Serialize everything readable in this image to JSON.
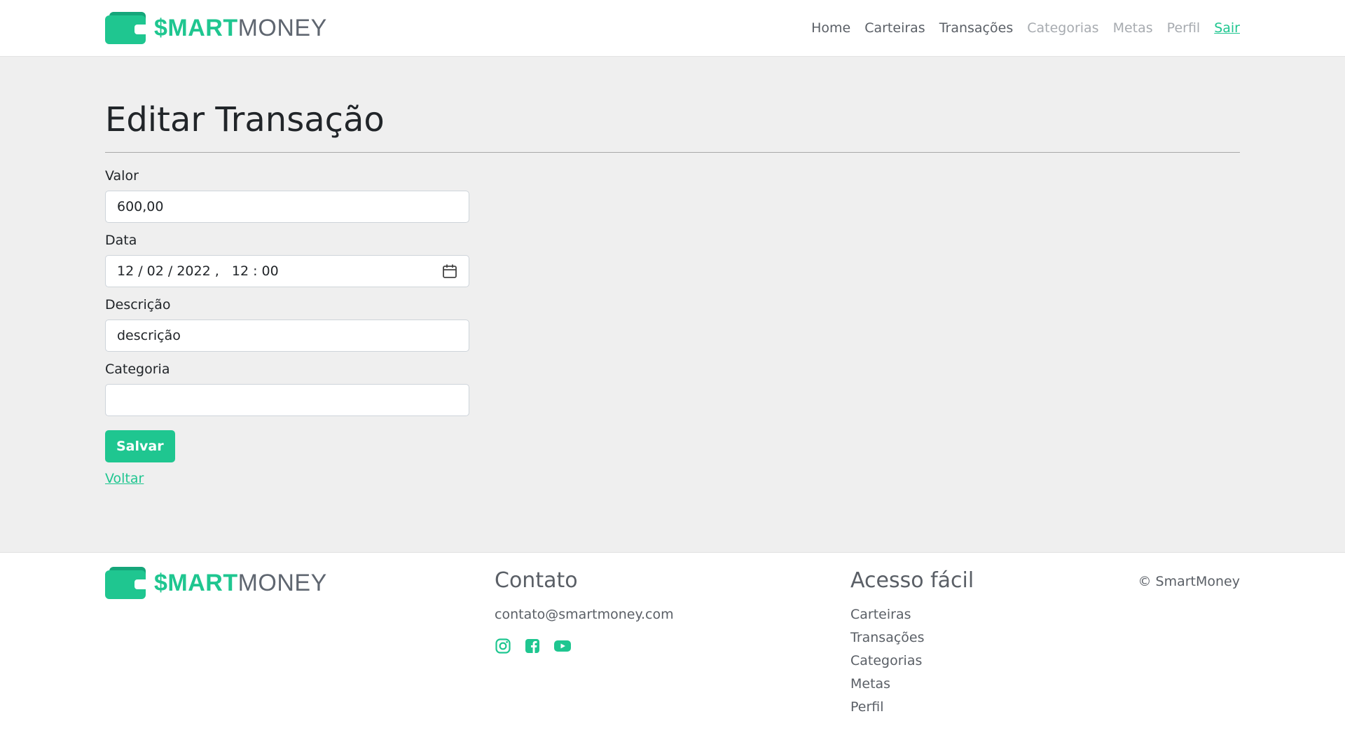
{
  "brand": {
    "bold": "$MART",
    "light": "MONEY"
  },
  "nav": {
    "items": [
      {
        "label": "Home",
        "state": "normal"
      },
      {
        "label": "Carteiras",
        "state": "normal"
      },
      {
        "label": "Transações",
        "state": "normal"
      },
      {
        "label": "Categorias",
        "state": "muted"
      },
      {
        "label": "Metas",
        "state": "muted"
      },
      {
        "label": "Perfil",
        "state": "muted"
      },
      {
        "label": "Sair",
        "state": "link"
      }
    ]
  },
  "page": {
    "title": "Editar Transação"
  },
  "form": {
    "valor": {
      "label": "Valor",
      "value": "600,00"
    },
    "data": {
      "label": "Data",
      "value": "12 / 02 / 2022 ,   12 : 00"
    },
    "descricao": {
      "label": "Descrição",
      "value": "descrição"
    },
    "categoria": {
      "label": "Categoria",
      "value": ""
    },
    "save_label": "Salvar",
    "back_label": "Voltar"
  },
  "footer": {
    "contact_title": "Contato",
    "email": "contato@smartmoney.com",
    "social": [
      "instagram-icon",
      "facebook-icon",
      "youtube-icon"
    ],
    "links_title": "Acesso fácil",
    "links": [
      "Carteiras",
      "Transações",
      "Categorias",
      "Metas",
      "Perfil"
    ],
    "copyright": "© SmartMoney"
  },
  "colors": {
    "accent": "#1fc690",
    "background": "#efefef",
    "text_muted": "#5a5f66"
  }
}
